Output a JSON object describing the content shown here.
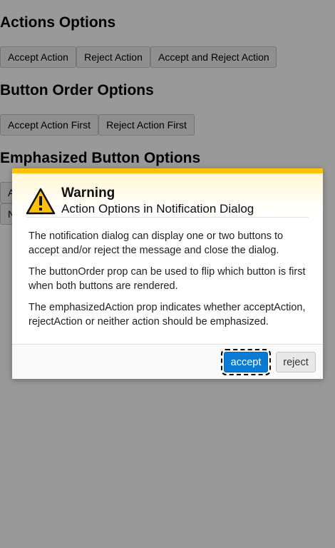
{
  "sections": {
    "actions": {
      "heading": "Actions Options",
      "buttons": [
        "Accept Action",
        "Reject Action",
        "Accept and Reject Action"
      ]
    },
    "button_order": {
      "heading": "Button Order Options",
      "buttons": [
        "Accept Action First",
        "Reject Action First"
      ]
    },
    "emphasized": {
      "heading": "Emphasized Button Options",
      "buttons_partial": [
        "A",
        "N"
      ]
    }
  },
  "dialog": {
    "title": "Warning",
    "subtitle": "Action Options in Notification Dialog",
    "paragraphs": [
      "The notification dialog can display one or two buttons to accept and/or reject the message and close the dialog.",
      "The buttonOrder prop can be used to flip which button is first when both buttons are rendered.",
      "The emphasizedAction prop indicates whether acceptAction, rejectAction or neither action should be emphasized."
    ],
    "accept_label": "accept",
    "reject_label": "reject",
    "icon": "warning-icon"
  },
  "colors": {
    "accent": "#ffc107",
    "accept_button": "#0a7bd4",
    "overlay": "rgba(0,0,0,0.40)"
  }
}
